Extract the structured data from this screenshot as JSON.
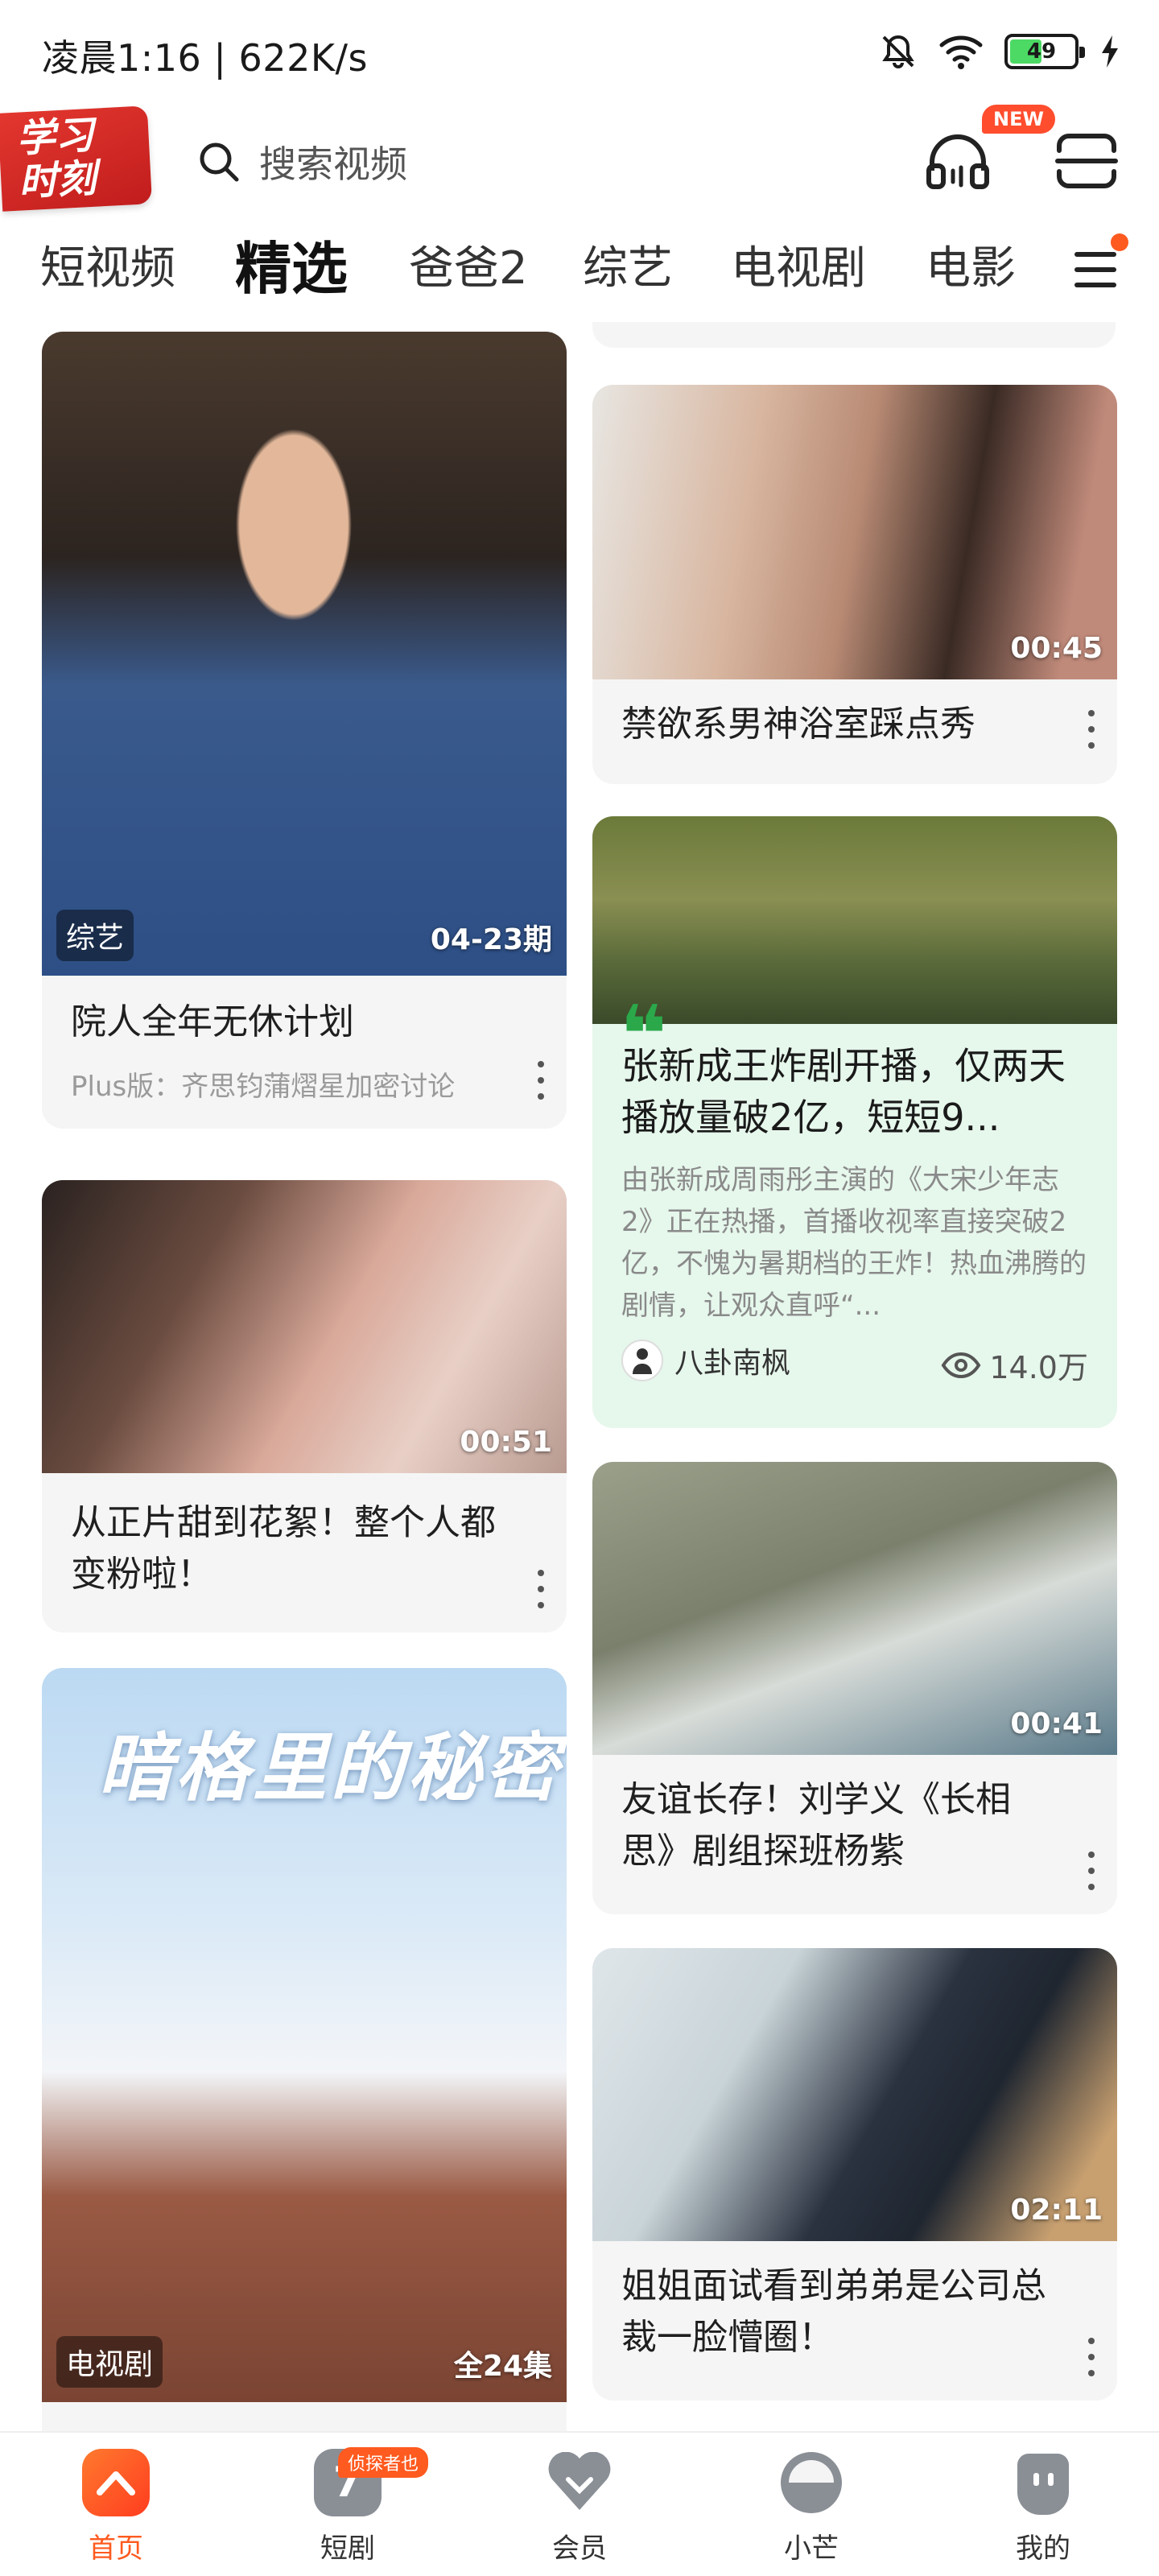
{
  "status_bar": {
    "time": "凌晨1:16 | 622K/s",
    "battery": "49",
    "battery_level": 0.49
  },
  "header": {
    "logo_text": "学习时刻",
    "search_placeholder": "搜索视频",
    "new_badge": "NEW",
    "icons": [
      "search-icon",
      "headphones-icon",
      "scan-icon"
    ]
  },
  "tabs": [
    {
      "label": "短视频"
    },
    {
      "label": "精选",
      "active": true
    },
    {
      "label": "爸爸2"
    },
    {
      "label": "综艺"
    },
    {
      "label": "电视剧"
    },
    {
      "label": "电影"
    }
  ],
  "cards": {
    "c1": {
      "tag": "综艺",
      "episode": "04-23期",
      "title": "院人全年无休计划",
      "subtitle": "Plus版：齐思钧蒲熠星加密讨论"
    },
    "c2": {
      "duration": "00:51",
      "title": "从正片甜到花絮！整个人都变粉啦！"
    },
    "c3": {
      "poster_text": "暗格里的秘密",
      "tag": "电视剧",
      "episodes": "全24集"
    },
    "c4": {
      "duration": "00:45",
      "title": "禁欲系男神浴室踩点秀"
    },
    "c5": {
      "title": "张新成王炸剧开播，仅两天播放量破2亿，短短9...",
      "desc": "由张新成周雨彤主演的《大宋少年志2》正在热播，首播收视率直接突破2亿，不愧为暑期档的王炸！热血沸腾的剧情，让观众直呼“...",
      "author": "八卦南枫",
      "views": "14.0万"
    },
    "c6": {
      "duration": "00:41",
      "title": "友谊长存！刘学义《长相思》剧组探班杨紫"
    },
    "c7": {
      "duration": "02:11",
      "title": "姐姐面试看到弟弟是公司总裁一脸懵圈！"
    }
  },
  "bottom_nav": [
    {
      "label": "首页",
      "active": true
    },
    {
      "label": "短剧",
      "badge": "侦探者也"
    },
    {
      "label": "会员"
    },
    {
      "label": "小芒"
    },
    {
      "label": "我的"
    }
  ],
  "colors": {
    "accent": "#ff5a1f",
    "featured_bg": "#e6f7ec",
    "quote_green": "#2ba84a"
  }
}
